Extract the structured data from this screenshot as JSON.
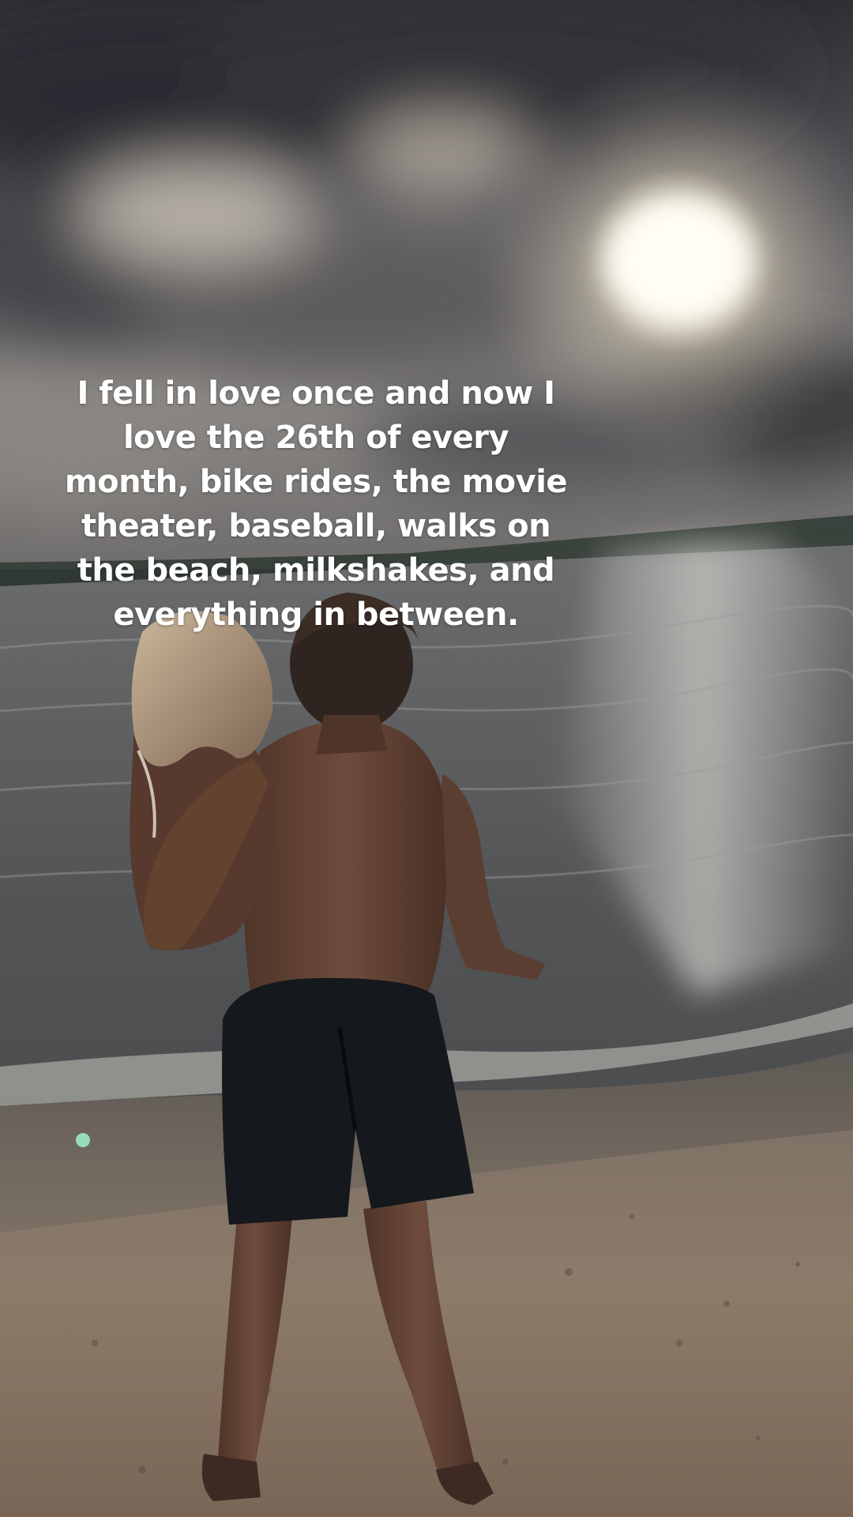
{
  "overlay": {
    "caption": "I fell in love once and now I love the 26th of every month, bike rides, the movie theater, baseball, walks on the beach, milkshakes, and everything in between."
  },
  "scene": {
    "subject": "couple at the beach, one person carrying the other toward the water",
    "palette": {
      "sky_dark": "#3b3b3e",
      "sky_light": "#8a8785",
      "sun": "#fffbe8",
      "water": "#5b5d5e",
      "sand": "#8d7b6a",
      "shorts": "#15181c",
      "skin": "#6a4a3a"
    }
  }
}
